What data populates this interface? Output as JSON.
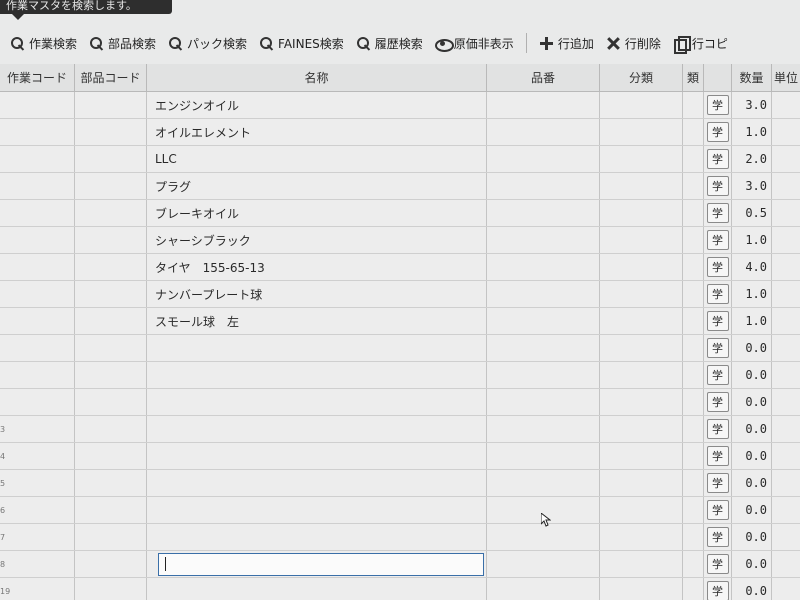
{
  "tooltip": {
    "text": "作業マスタを検索します。"
  },
  "toolbar": {
    "buttons": [
      {
        "label": "作業検索",
        "icon": "search-icon"
      },
      {
        "label": "部品検索",
        "icon": "search-icon"
      },
      {
        "label": "パック検索",
        "icon": "search-icon"
      },
      {
        "label": "FAINES検索",
        "icon": "search-icon"
      },
      {
        "label": "履歴検索",
        "icon": "search-icon"
      },
      {
        "label": "原価非表示",
        "icon": "eye-icon"
      },
      {
        "label": "行追加",
        "icon": "plus-icon"
      },
      {
        "label": "行削除",
        "icon": "x-icon"
      },
      {
        "label": "行コピ",
        "icon": "copy-icon"
      }
    ]
  },
  "grid": {
    "columns": {
      "sagyo_code": "作業コード",
      "buhin_code": "部品コード",
      "meisho": "名称",
      "hinban": "品番",
      "bunrui": "分類",
      "rui": "類",
      "suryo": "数量",
      "tani": "単位"
    },
    "row_button_label": "学",
    "rows": [
      {
        "num": "",
        "meisho": "エンジンオイル",
        "suryo": "3.0"
      },
      {
        "num": "",
        "meisho": "オイルエレメント",
        "suryo": "1.0"
      },
      {
        "num": "",
        "meisho": "LLC",
        "suryo": "2.0"
      },
      {
        "num": "",
        "meisho": "プラグ",
        "suryo": "3.0"
      },
      {
        "num": "",
        "meisho": "ブレーキオイル",
        "suryo": "0.5"
      },
      {
        "num": "",
        "meisho": "シャーシブラック",
        "suryo": "1.0"
      },
      {
        "num": "",
        "meisho": "タイヤ　155-65-13",
        "suryo": "4.0"
      },
      {
        "num": "",
        "meisho": "ナンバープレート球",
        "suryo": "1.0"
      },
      {
        "num": "",
        "meisho": "スモール球　左",
        "suryo": "1.0"
      },
      {
        "num": "",
        "meisho": "",
        "suryo": "0.0"
      },
      {
        "num": "",
        "meisho": "",
        "suryo": "0.0"
      },
      {
        "num": "",
        "meisho": "",
        "suryo": "0.0"
      },
      {
        "num": "3",
        "meisho": "",
        "suryo": "0.0"
      },
      {
        "num": "4",
        "meisho": "",
        "suryo": "0.0"
      },
      {
        "num": "5",
        "meisho": "",
        "suryo": "0.0"
      },
      {
        "num": "6",
        "meisho": "",
        "suryo": "0.0"
      },
      {
        "num": "7",
        "meisho": "",
        "suryo": "0.0"
      },
      {
        "num": "8",
        "meisho": "",
        "suryo": "0.0",
        "editing": true
      },
      {
        "num": "19",
        "meisho": "",
        "suryo": "0.0"
      }
    ]
  }
}
